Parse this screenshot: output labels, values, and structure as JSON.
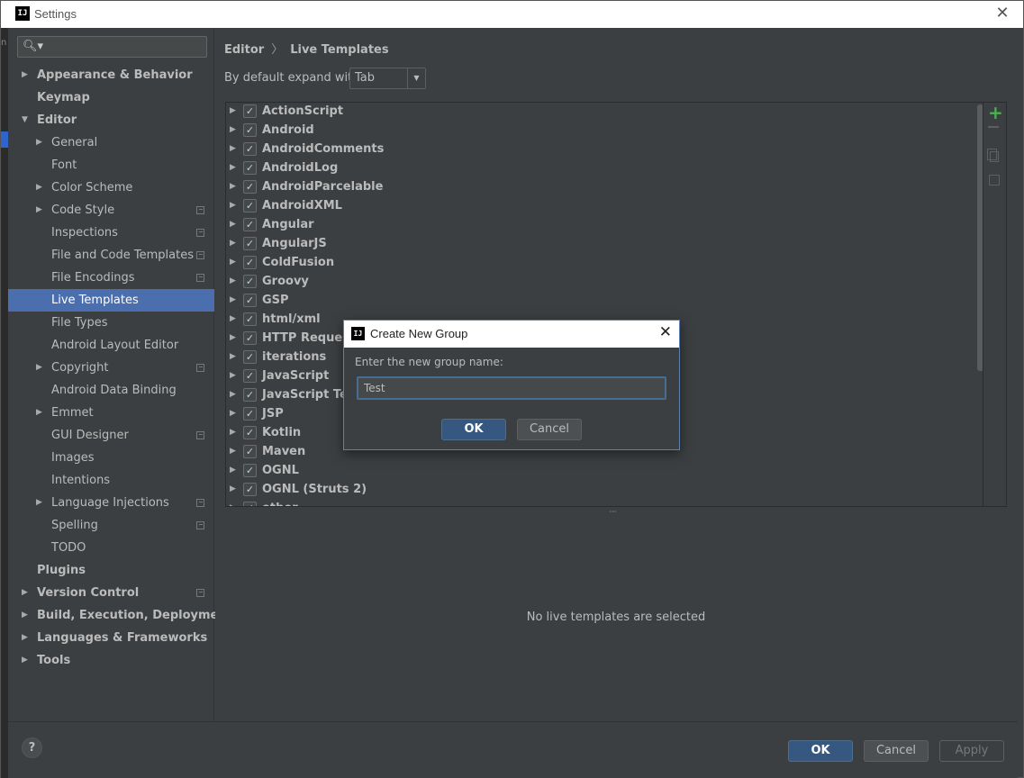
{
  "window": {
    "title": "Settings",
    "app_icon": "IJ"
  },
  "search": {
    "value": ""
  },
  "sidebar": {
    "items": [
      {
        "label": "Appearance & Behavior",
        "arrow": "▶"
      },
      {
        "label": "Keymap",
        "arrow": ""
      },
      {
        "label": "Editor",
        "arrow": "▼"
      },
      {
        "label": "General",
        "arrow": "▶"
      },
      {
        "label": "Font",
        "arrow": ""
      },
      {
        "label": "Color Scheme",
        "arrow": "▶"
      },
      {
        "label": "Code Style",
        "arrow": "▶"
      },
      {
        "label": "Inspections",
        "arrow": ""
      },
      {
        "label": "File and Code Templates",
        "arrow": ""
      },
      {
        "label": "File Encodings",
        "arrow": ""
      },
      {
        "label": "Live Templates",
        "arrow": ""
      },
      {
        "label": "File Types",
        "arrow": ""
      },
      {
        "label": "Android Layout Editor",
        "arrow": ""
      },
      {
        "label": "Copyright",
        "arrow": "▶"
      },
      {
        "label": "Android Data Binding",
        "arrow": ""
      },
      {
        "label": "Emmet",
        "arrow": "▶"
      },
      {
        "label": "GUI Designer",
        "arrow": ""
      },
      {
        "label": "Images",
        "arrow": ""
      },
      {
        "label": "Intentions",
        "arrow": ""
      },
      {
        "label": "Language Injections",
        "arrow": "▶"
      },
      {
        "label": "Spelling",
        "arrow": ""
      },
      {
        "label": "TODO",
        "arrow": ""
      },
      {
        "label": "Plugins",
        "arrow": ""
      },
      {
        "label": "Version Control",
        "arrow": "▶"
      },
      {
        "label": "Build, Execution, Deployment",
        "arrow": "▶"
      },
      {
        "label": "Languages & Frameworks",
        "arrow": "▶"
      },
      {
        "label": "Tools",
        "arrow": "▶"
      }
    ]
  },
  "breadcrumb": {
    "parent": "Editor",
    "separator": "〉",
    "current": "Live Templates"
  },
  "expand": {
    "label": "By default expand with",
    "value": "Tab",
    "dropdown_icon": "▼"
  },
  "template_groups": [
    "ActionScript",
    "Android",
    "AndroidComments",
    "AndroidLog",
    "AndroidParcelable",
    "AndroidXML",
    "Angular",
    "AngularJS",
    "ColdFusion",
    "Groovy",
    "GSP",
    "html/xml",
    "HTTP Request",
    "iterations",
    "JavaScript",
    "JavaScript Testing",
    "JSP",
    "Kotlin",
    "Maven",
    "OGNL",
    "OGNL (Struts 2)",
    "other"
  ],
  "tree_arrow": "▶",
  "check_mark": "✓",
  "toolbar": {
    "add_icon": "+"
  },
  "details": {
    "empty_message": "No live templates are selected"
  },
  "footer": {
    "help_label": "?",
    "ok_label": "OK",
    "cancel_label": "Cancel",
    "apply_label": "Apply"
  },
  "dialog": {
    "title": "Create New Group",
    "prompt": "Enter the new group name:",
    "input_value": "Test",
    "ok_label": "OK",
    "cancel_label": "Cancel",
    "close_icon": "✕"
  },
  "colors": {
    "selection": "#4b6eaf",
    "primary_button": "#365880",
    "add": "#4caf50",
    "background": "#3c3f41"
  }
}
